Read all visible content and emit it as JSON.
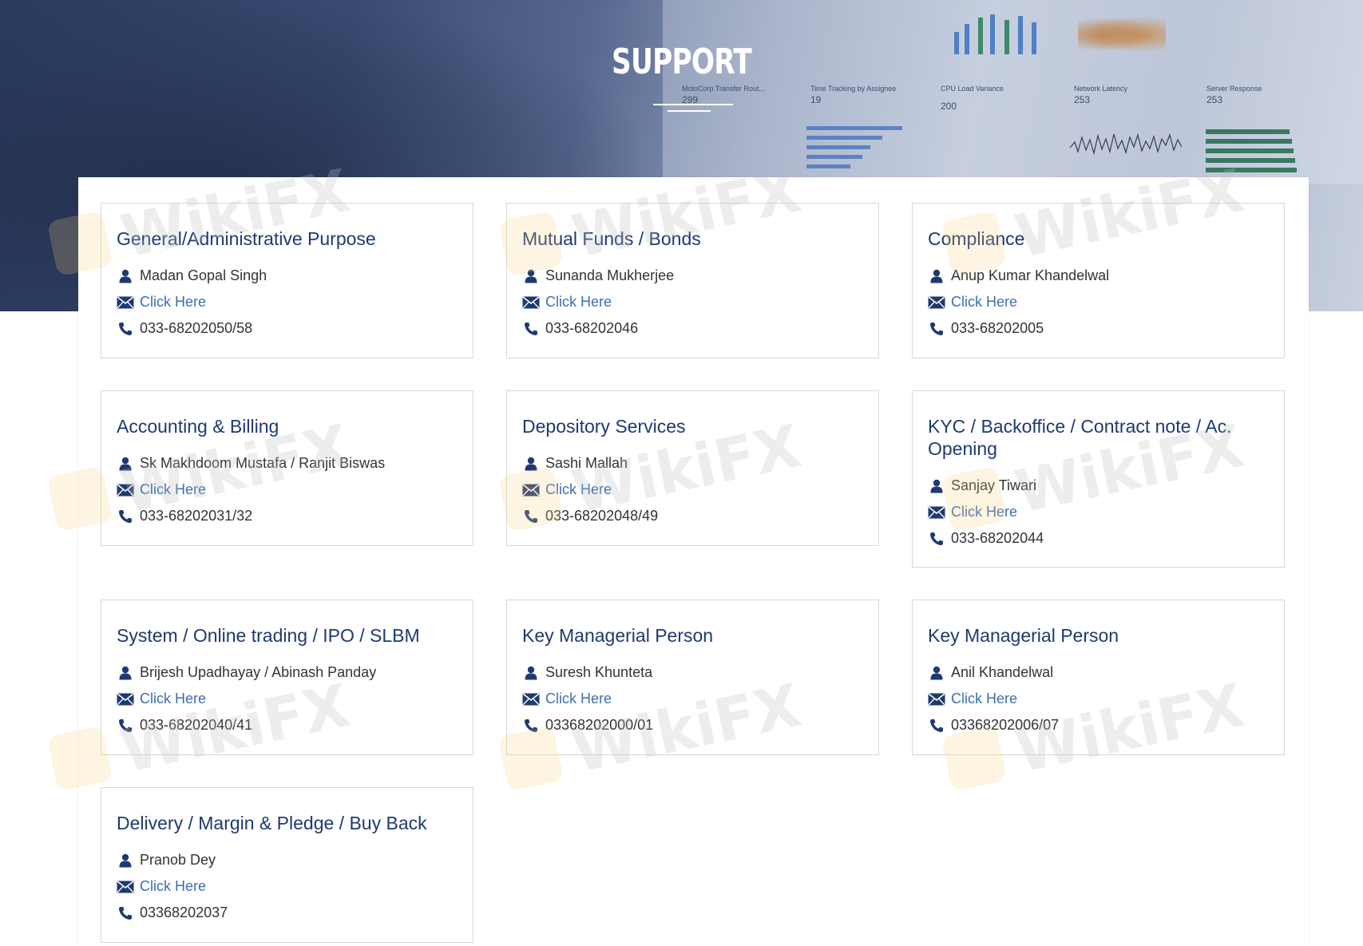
{
  "page": {
    "title": "SUPPORT"
  },
  "watermark": {
    "text": "WikiFX"
  },
  "colors": {
    "title_text": "#1e3a70",
    "link": "#3d6fb0",
    "body_text": "#333333",
    "card_border": "#d8d8d8",
    "icon": "#1e3a70"
  },
  "hero_panels": {
    "labels": [
      "MotoCorp Transfer Rout...",
      "Time Tracking by Assignee",
      "CPU Load Variance",
      "Network Latency",
      "Server Response"
    ],
    "numbers": [
      "299",
      "19",
      "200",
      "253",
      "253"
    ]
  },
  "cards": [
    {
      "title": "General/Administrative Purpose",
      "person": "Madan Gopal Singh",
      "email_label": "Click Here",
      "phone": "033-68202050/58"
    },
    {
      "title": "Mutual Funds / Bonds",
      "person": "Sunanda Mukherjee",
      "email_label": "Click Here",
      "phone": "033-68202046"
    },
    {
      "title": "Compliance",
      "person": "Anup Kumar Khandelwal",
      "email_label": "Click Here",
      "phone": "033-68202005"
    },
    {
      "title": "Accounting & Billing",
      "person": "Sk Makhdoom Mustafa / Ranjit Biswas",
      "email_label": "Click Here",
      "phone": "033-68202031/32"
    },
    {
      "title": "Depository Services",
      "person": "Sashi Mallah",
      "email_label": "Click Here",
      "phone": "033-68202048/49"
    },
    {
      "title": "KYC / Backoffice / Contract note / Ac. Opening",
      "person": "Sanjay Tiwari",
      "email_label": "Click Here",
      "phone": "033-68202044"
    },
    {
      "title": "System / Online trading / IPO / SLBM",
      "person": "Brijesh Upadhayay / Abinash Panday",
      "email_label": "Click Here",
      "phone": "033-68202040/41"
    },
    {
      "title": "Key Managerial Person",
      "person": "Suresh Khunteta",
      "email_label": "Click Here",
      "phone": "03368202000/01"
    },
    {
      "title": "Key Managerial Person",
      "person": "Anil Khandelwal",
      "email_label": "Click Here",
      "phone": "03368202006/07"
    },
    {
      "title": "Delivery / Margin & Pledge / Buy Back",
      "person": "Pranob Dey",
      "email_label": "Click Here",
      "phone": "03368202037"
    }
  ]
}
